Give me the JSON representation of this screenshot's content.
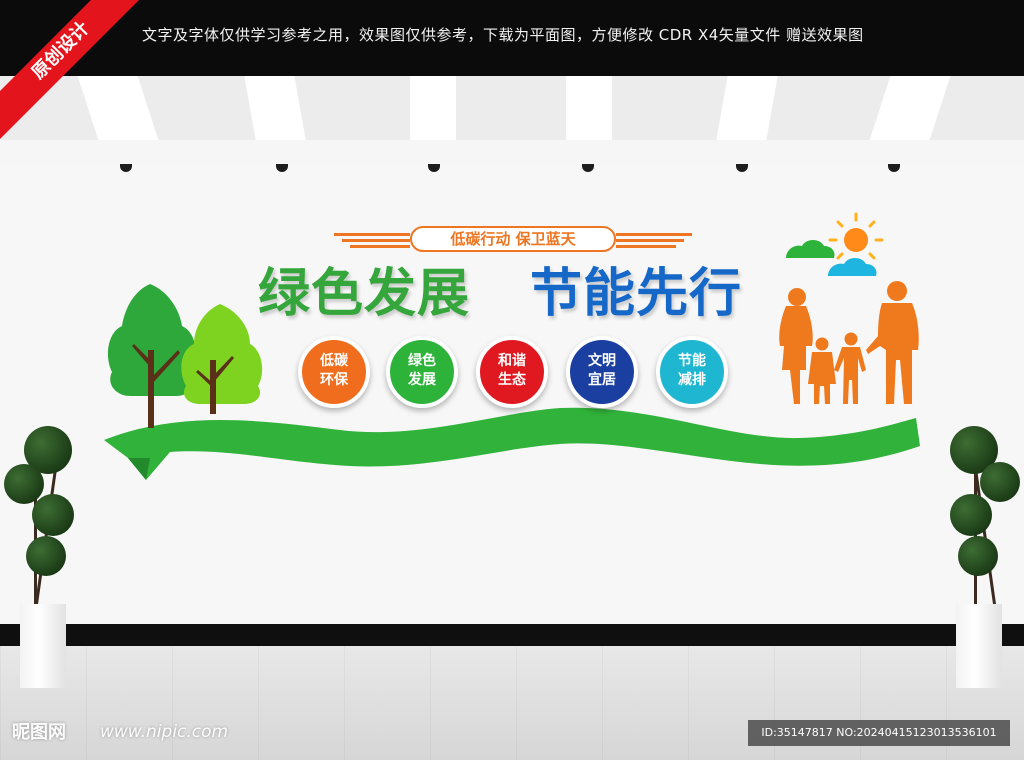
{
  "corner_badge": {
    "text": "原创设计",
    "color": "#e4141d"
  },
  "top_banner": {
    "text": "文字及字体仅供学习参考之用，效果图仅供参考，下载为平面图，方便修改    CDR X4矢量文件  赠送效果图"
  },
  "wall_design": {
    "subtitle": "低碳行动  保卫蓝天",
    "title_green": "绿色发展",
    "title_blue": "节能先行",
    "colors": {
      "green": "#35a63b",
      "blue": "#1567c8",
      "orange": "#ee7622"
    },
    "circles": [
      {
        "line1": "低碳",
        "line2": "环保",
        "color": "#ef6d1c"
      },
      {
        "line1": "绿色",
        "line2": "发展",
        "color": "#2eb33a"
      },
      {
        "line1": "和谐",
        "line2": "生态",
        "color": "#e0181f"
      },
      {
        "line1": "文明",
        "line2": "宜居",
        "color": "#1a3fa0"
      },
      {
        "line1": "节能",
        "line2": "减排",
        "color": "#1eb6d0"
      }
    ],
    "icons": [
      "tree-icon",
      "sun-icon",
      "cloud-icon",
      "family-silhouette-icon",
      "wave-ribbon"
    ]
  },
  "footer": {
    "watermark": "昵图网",
    "url": "www.nipic.com",
    "id_text": "ID:35147817 NO:20240415123013536101"
  }
}
